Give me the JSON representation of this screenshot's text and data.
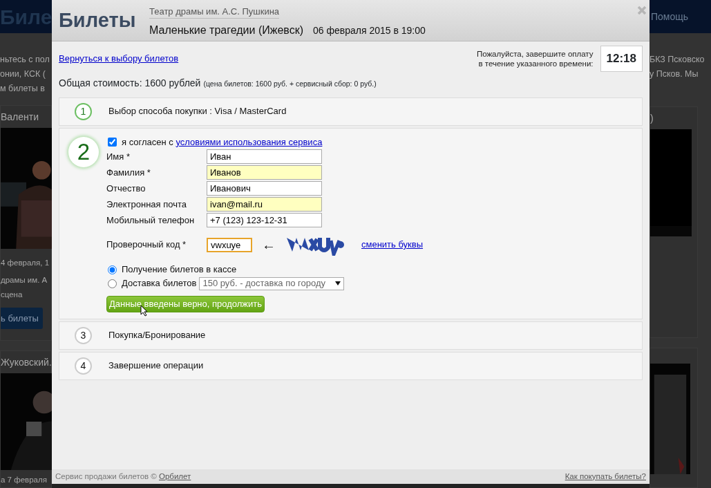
{
  "background_page": {
    "logo": "Биле",
    "nav_item": "Помощь",
    "left_texts": [
      "ньтесь с пол",
      "онии, КСК (",
      "м билеты в"
    ],
    "right_texts": [
      "БКЗ Псковско",
      "у Псков. Мы"
    ],
    "left_cards": [
      {
        "title": "Валенти",
        "lines": [
          "4 февраля, 1",
          "драмы им. А",
          "сцена"
        ],
        "button": "ь билеты"
      },
      {
        "title": "Жуковский.",
        "lines": [
          "а 7 февраля"
        ]
      }
    ],
    "right_card_title": ")"
  },
  "modal": {
    "logo": "Билеты",
    "venue": "Театр драмы им. А.С. Пушкина",
    "show": "Маленькие трагедии (Ижевск)",
    "datetime": "06 февраля 2015 в 19:00",
    "back_link": "Вернуться к выбору билетов",
    "timer_note": "Пожалуйста, завершите оплату в течение указанного времени:",
    "timer": "12:18",
    "total": "Общая стоимость: 1600 рублей",
    "total_detail": "(цена билетов: 1600 руб. + сервисный сбор: 0 руб.)",
    "steps": [
      {
        "number": "1",
        "title": "Выбор способа покупки : Visa / MasterCard",
        "expanded": false,
        "done": true
      },
      {
        "number": "2",
        "expanded": true
      },
      {
        "number": "3",
        "title": "Покупка/Бронирование",
        "expanded": false,
        "done": false
      },
      {
        "number": "4",
        "title": "Завершение операции",
        "expanded": false,
        "done": false
      }
    ],
    "form": {
      "agree": {
        "checked": true,
        "text": "я согласен с",
        "link": "условиями использования сервиса"
      },
      "fields": [
        {
          "label": "Имя *",
          "value": "Иван",
          "highlighted": false
        },
        {
          "label": "Фамилия *",
          "value": "Иванов",
          "highlighted": true
        },
        {
          "label": "Отчество",
          "value": "Иванович",
          "highlighted": false
        },
        {
          "label": "Электронная почта",
          "value": "ivan@mail.ru",
          "highlighted": true
        },
        {
          "label": "Мобильный телефон",
          "value": "+7 (123) 123-12-31",
          "highlighted": false
        }
      ],
      "captcha": {
        "label": "Проверочный код *",
        "value": "vwxuye",
        "focused": true,
        "arrow": "←",
        "change_link": "сменить буквы"
      },
      "delivery": [
        {
          "label": "Получение билетов в кассе",
          "selected": true
        },
        {
          "label": "Доставка билетов",
          "selected": false,
          "select": "150 руб. - доставка по городу"
        }
      ],
      "submit": "Данные введены верно, продолжить"
    },
    "footer": {
      "text": "Сервис продажи билетов ©",
      "link": "Орбилет",
      "help": "Как покупать билеты?"
    }
  }
}
